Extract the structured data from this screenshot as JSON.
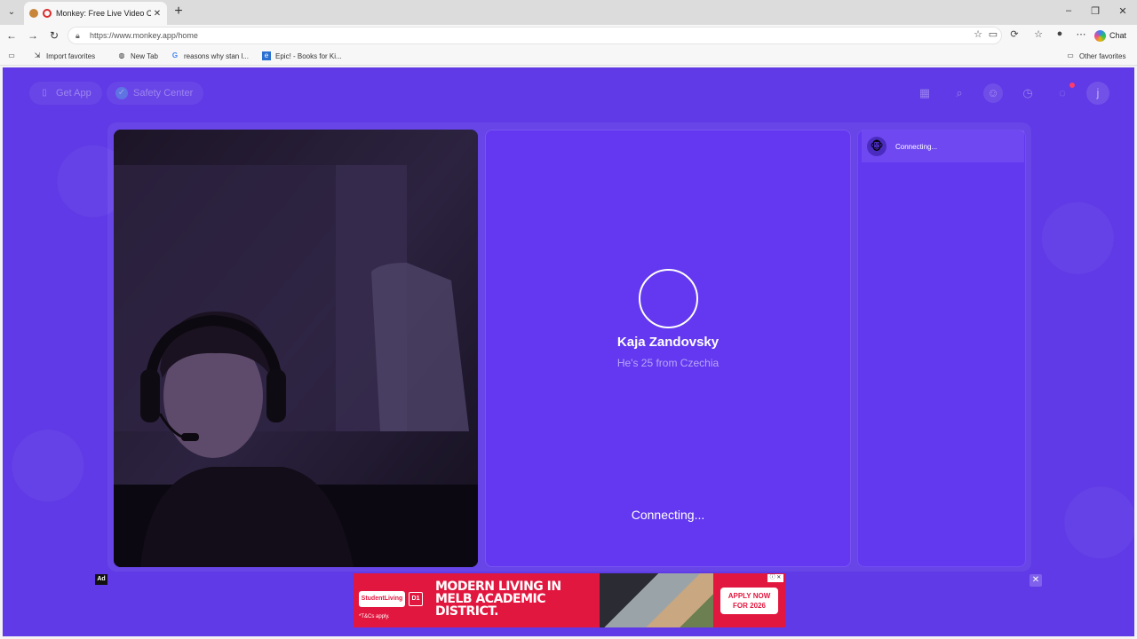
{
  "browser": {
    "tab_title": "Monkey: Free Live Video Chat",
    "url": "https://www.monkey.app/home",
    "chat_button": "Chat",
    "bookmarks": [
      {
        "label": "Import favorites",
        "icon": "import-icon"
      },
      {
        "label": "New Tab",
        "icon": "globe-icon"
      },
      {
        "label": "reasons why stan l...",
        "icon": "google-icon"
      },
      {
        "label": "Epic! - Books for Ki...",
        "icon": "epic-icon"
      }
    ],
    "other_favorites": "Other favorites"
  },
  "header": {
    "get_app": "Get App",
    "safety_center": "Safety Center",
    "avatar_letter": "j",
    "icons": [
      "shop-icon",
      "search-icon",
      "monkey-icon",
      "history-icon",
      "messages-icon"
    ]
  },
  "partner": {
    "name": "Kaja Zandovsky",
    "subtitle": "He's 25 from Czechia",
    "status": "Connecting..."
  },
  "chat": {
    "status": "Connecting..."
  },
  "ad": {
    "label": "Ad",
    "logo": "StudentLiving",
    "badge": "D1",
    "headline": "MODERN LIVING IN MELB ACADEMIC DISTRICT.",
    "terms": "*T&Cs apply.",
    "cta": "APPLY NOW FOR 2026",
    "close": "✕"
  },
  "colors": {
    "page_bg": "#5f3ae6",
    "card_bg": "#6338f0",
    "ad_red": "#e2173f"
  }
}
